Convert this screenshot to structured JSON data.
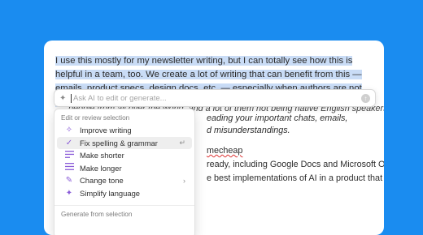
{
  "document": {
    "selected_paragraph": "I use this mostly for my newsletter writing, but I can totally see how this is helpful in a team, too. We create a lot of writing that can benefit from this — emails, product specs, design docs, etc. — especially when authors are not native speakers, or are not particularly versed in writing.",
    "bg_line_1": "peoplе from all over the world, and a lot of them not being native English speakers,",
    "bg_line_2": "eading your important chats, emails,",
    "bg_line_3": "d misunderstandings.",
    "bg_line_4": "mecheap",
    "bg_line_5": "ready, including Google Docs and Microsoft Office",
    "bg_line_6": "e best implementations of AI in a product that I have"
  },
  "ai_prompt": {
    "placeholder": "Ask AI to edit or generate...",
    "icon": "sparkle-icon",
    "submit_icon": "arrow-up-icon"
  },
  "menu": {
    "section_edit": "Edit or review selection",
    "items": [
      {
        "label": "Improve writing",
        "icon": "sparkle-icon",
        "right": ""
      },
      {
        "label": "Fix spelling & grammar",
        "icon": "check-icon",
        "right": "↵"
      },
      {
        "label": "Make shorter",
        "icon": "lines-short-icon",
        "right": ""
      },
      {
        "label": "Make longer",
        "icon": "lines-long-icon",
        "right": ""
      },
      {
        "label": "Change tone",
        "icon": "pen-icon",
        "right": "›"
      },
      {
        "label": "Simplify language",
        "icon": "sparkle-icon",
        "right": ""
      }
    ],
    "section_generate": "Generate from selection"
  },
  "colors": {
    "background": "#1a8cf0",
    "selection": "#c9dcf6",
    "accent": "#8a5cd8"
  }
}
